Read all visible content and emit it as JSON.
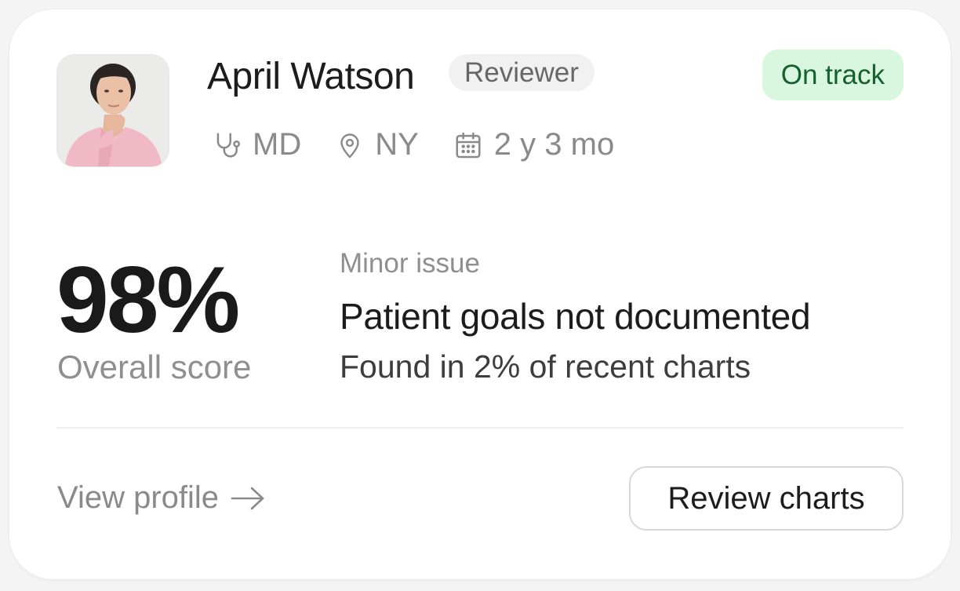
{
  "reviewer": {
    "name": "April Watson",
    "role": "Reviewer",
    "avatar_icon": "person-photo",
    "credential": "MD",
    "credential_icon": "stethoscope-icon",
    "location": "NY",
    "location_icon": "map-pin-icon",
    "tenure": "2 y 3 mo",
    "tenure_icon": "calendar-icon"
  },
  "status": {
    "label": "On track",
    "background": "#d9f7df",
    "color": "#15602d"
  },
  "score": {
    "value": "98%",
    "label": "Overall score"
  },
  "issue": {
    "severity": "Minor issue",
    "title": "Patient goals not documented",
    "detail": "Found in 2% of recent charts"
  },
  "actions": {
    "view_profile": "View profile",
    "view_profile_icon": "arrow-right-icon",
    "review_charts": "Review charts"
  }
}
